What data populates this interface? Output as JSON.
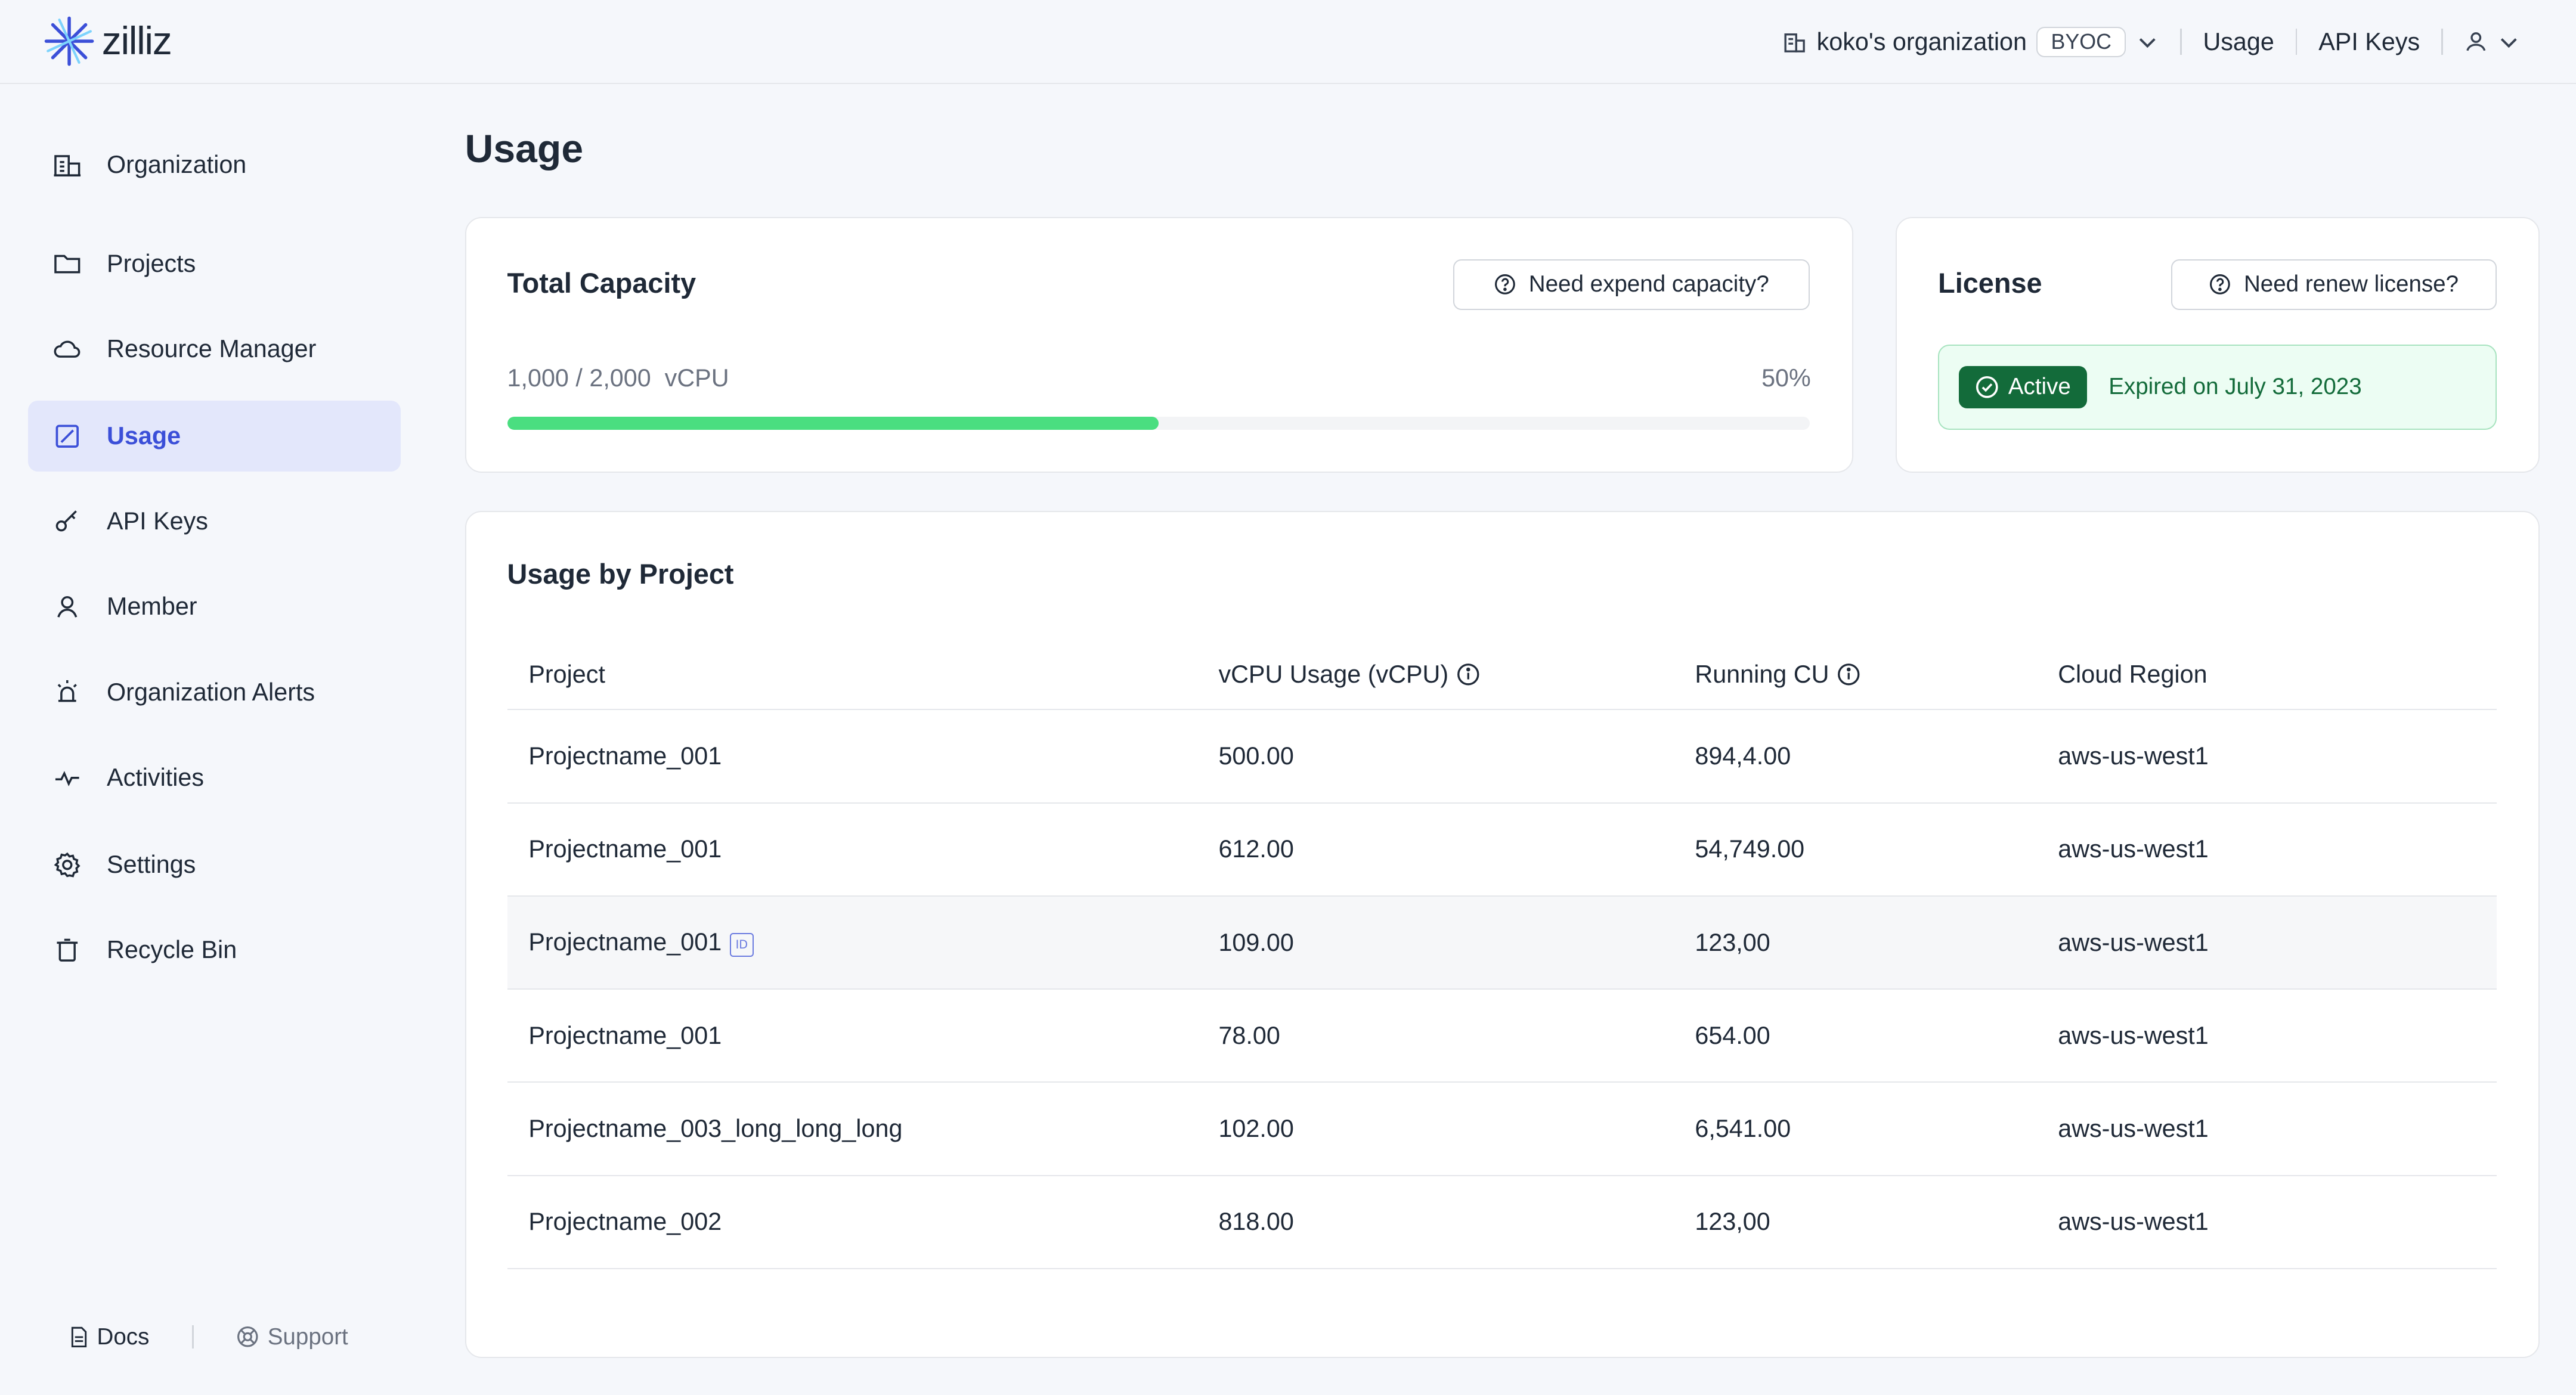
{
  "brand": {
    "name": "zilliz",
    "accent": "#3b4fd8"
  },
  "header": {
    "org_name": "koko's organization",
    "org_badge": "BYOC",
    "links": [
      "Usage",
      "API Keys"
    ]
  },
  "sidebar": {
    "items": [
      {
        "label": "Organization",
        "icon": "building-icon"
      },
      {
        "label": "Projects",
        "icon": "folder-icon"
      },
      {
        "label": "Resource Manager",
        "icon": "cloud-icon"
      },
      {
        "label": "Usage",
        "icon": "usage-icon",
        "active": true
      },
      {
        "label": "API Keys",
        "icon": "key-icon"
      },
      {
        "label": "Member",
        "icon": "user-icon"
      },
      {
        "label": "Organization Alerts",
        "icon": "alarm-icon"
      },
      {
        "label": "Activities",
        "icon": "activity-icon"
      },
      {
        "label": "Settings",
        "icon": "gear-icon"
      },
      {
        "label": "Recycle Bin",
        "icon": "trash-icon"
      }
    ],
    "footer": {
      "docs": "Docs",
      "support": "Support"
    }
  },
  "page": {
    "title": "Usage"
  },
  "capacity": {
    "title": "Total Capacity",
    "button": "Need expend capacity?",
    "used_text": "1,000 / 2,000  vCPU",
    "percent_text": "50%",
    "fraction": 0.5
  },
  "license": {
    "title": "License",
    "button": "Need renew license?",
    "status": "Active",
    "expiry": "Expired on July 31, 2023",
    "status_color": "#136b3a"
  },
  "usage_table": {
    "title": "Usage by Project",
    "columns": [
      "Project",
      "vCPU Usage (vCPU)",
      "Running CU",
      "Cloud Region"
    ],
    "rows": [
      {
        "project": "Projectname_001",
        "vcpu": "500.00",
        "cu": "894,4.00",
        "region": "aws-us-west1"
      },
      {
        "project": "Projectname_001",
        "vcpu": "612.00",
        "cu": "54,749.00",
        "region": "aws-us-west1"
      },
      {
        "project": "Projectname_001",
        "vcpu": "109.00",
        "cu": "123,00",
        "region": "aws-us-west1",
        "id_badge": "ID"
      },
      {
        "project": "Projectname_001",
        "vcpu": "78.00",
        "cu": "654.00",
        "region": "aws-us-west1"
      },
      {
        "project": "Projectname_003_long_long_long",
        "vcpu": "102.00",
        "cu": "6,541.00",
        "region": "aws-us-west1"
      },
      {
        "project": "Projectname_002",
        "vcpu": "818.00",
        "cu": "123,00",
        "region": "aws-us-west1"
      }
    ]
  }
}
